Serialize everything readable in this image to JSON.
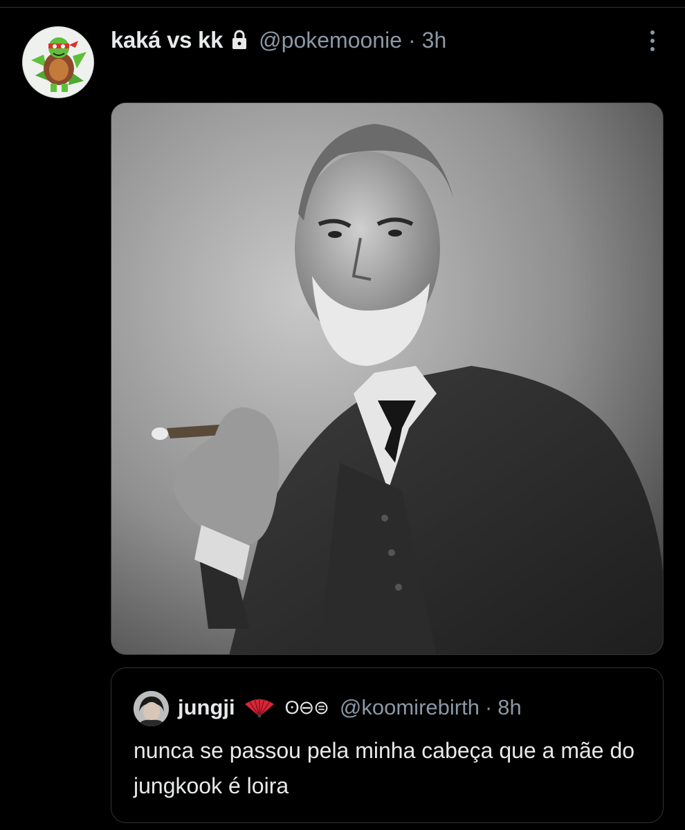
{
  "tweet": {
    "display_name": "kaká vs kk",
    "handle": "@pokemoonie",
    "separator": "·",
    "time": "3h",
    "avatar_icon": "cartoon-turtle-avatar",
    "lock_icon": "lock-icon",
    "more_icon": "more-options-icon"
  },
  "quoted_tweet": {
    "display_name": "jungji",
    "badge_emoji_icon": "folding-fan-icon",
    "symbols": "ʘ⊖⊜",
    "handle": "@koomirebirth",
    "separator": "·",
    "time": "8h",
    "text": "nunca se passou pela minha cabeça que a mãe do jungkook é loira"
  },
  "colors": {
    "background": "#000000",
    "primary_text": "#e7e9ea",
    "secondary_text": "#8b98a5",
    "border": "#2f3336",
    "fan_red": "#d62839"
  }
}
